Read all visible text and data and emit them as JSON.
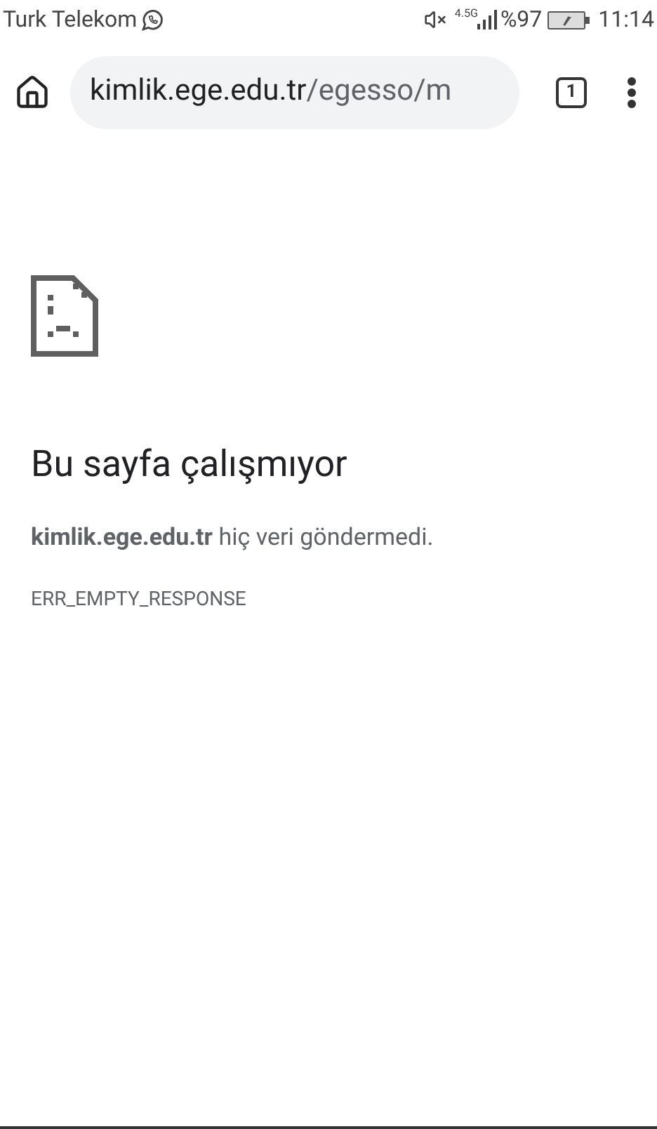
{
  "status_bar": {
    "carrier": "Turk Telekom",
    "network": "4.5G",
    "battery": "%97",
    "time": "11:14"
  },
  "toolbar": {
    "url": {
      "host": "kimlik.ege.edu.tr",
      "path": "/egesso/m"
    },
    "tab_count": "1"
  },
  "error": {
    "title": "Bu sayfa çalışmıyor",
    "message": "**kimlik.ege.edu.tr** hiç veri göndermedi.",
    "code": "ERR_EMPTY_RESPONSE"
  }
}
